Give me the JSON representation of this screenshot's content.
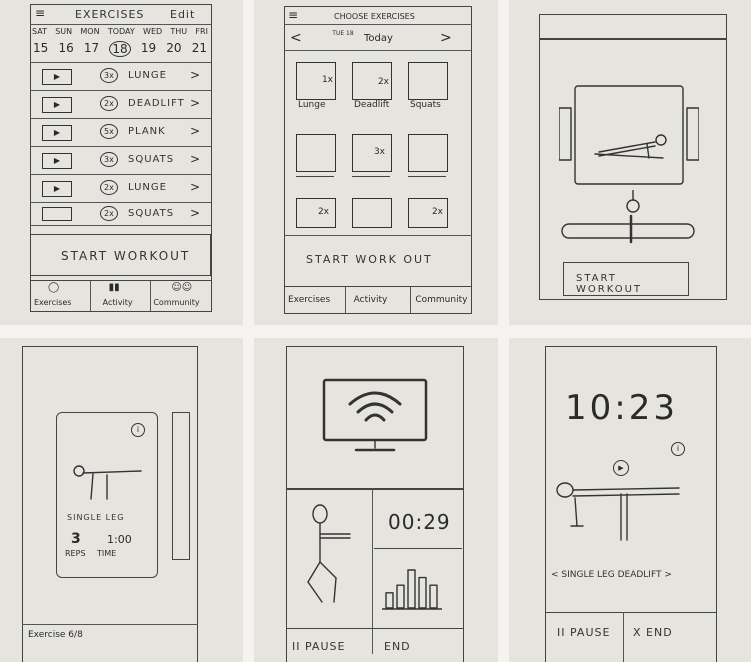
{
  "sketch1": {
    "header_title": "EXERCISES",
    "edit_label": "Edit",
    "days": [
      "SAT",
      "SUN",
      "MON",
      "TODAY",
      "WED",
      "THU",
      "FRI"
    ],
    "dates": [
      "15",
      "16",
      "17",
      "18",
      "19",
      "20",
      "21"
    ],
    "items": [
      {
        "reps": "3x",
        "name": "LUNGE"
      },
      {
        "reps": "2x",
        "name": "DEADLIFT"
      },
      {
        "reps": "5x",
        "name": "PLANK"
      },
      {
        "reps": "3x",
        "name": "SQUATS"
      },
      {
        "reps": "2x",
        "name": "LUNGE"
      },
      {
        "reps": "2x",
        "name": "SQUATS"
      }
    ],
    "start_label": "START WORKOUT",
    "tabs": [
      "Exercises",
      "Activity",
      "Community"
    ]
  },
  "sketch2": {
    "header_title": "CHOOSE EXERCISES",
    "date_small": "TUE 18",
    "date_label": "Today",
    "grid": [
      {
        "badge": "1x",
        "label": "Lunge"
      },
      {
        "badge": "2x",
        "label": "Deadlift"
      },
      {
        "badge": "",
        "label": "Squats"
      },
      {
        "badge": "",
        "label": ""
      },
      {
        "badge": "3x",
        "label": ""
      },
      {
        "badge": "",
        "label": ""
      },
      {
        "badge": "2x",
        "label": ""
      },
      {
        "badge": "",
        "label": ""
      },
      {
        "badge": "2x",
        "label": ""
      }
    ],
    "start_label": "START WORK OUT",
    "tabs": [
      "Exercises",
      "Activity",
      "Community"
    ]
  },
  "sketch3": {
    "start_label": "START WORKOUT"
  },
  "sketch4": {
    "exercise_name": "SINGLE LEG",
    "reps_value": "3",
    "reps_label": "REPS",
    "time_value": "1:00",
    "time_label": "TIME",
    "footer": "Exercise 6/8",
    "info_glyph": "i"
  },
  "sketch5": {
    "timer": "00:29",
    "pause_label": "II PAUSE",
    "end_label": "END",
    "bar_values": [
      2,
      3,
      5,
      4,
      3
    ]
  },
  "sketch6": {
    "timer": "10:23",
    "exercise_label": "< SINGLE LEG DEADLIFT >",
    "pause_label": "II PAUSE",
    "end_label": "X END",
    "info_glyph": "i"
  }
}
